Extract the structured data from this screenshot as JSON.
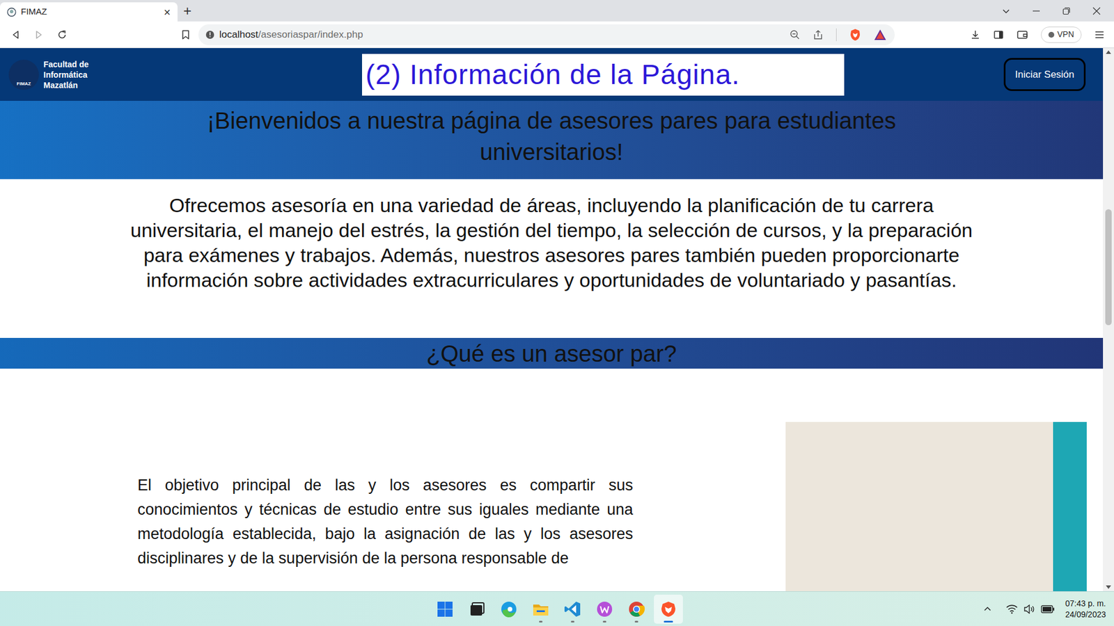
{
  "window": {
    "url_host": "localhost",
    "url_path": "/asesoriaspar/index.php",
    "vpn": "VPN"
  },
  "tabs": [
    {
      "label": "FIMAZ",
      "selected": true,
      "close": "×"
    }
  ],
  "new_tab": "+",
  "header": {
    "logo_mark": "FIMAZ",
    "logo_lines": [
      "Facultad de",
      "Informática",
      "Mazatlán"
    ],
    "title": "(2) Información de la Página.",
    "login": "Iniciar Sesión"
  },
  "banner": {
    "heading": "¡Bienvenidos a nuestra página de asesores pares para estudiantes universitarios!"
  },
  "intro": "Ofrecemos asesoría en una variedad de áreas, incluyendo la planificación de tu carrera universitaria, el manejo del estrés, la gestión del tiempo, la selección de cursos, y la preparación para exámenes y trabajos. Además, nuestros asesores pares también pueden proporcionarte información sobre actividades extracurriculares y oportunidades de voluntariado y pasantías.",
  "section": {
    "heading": "¿Qué es un asesor par?",
    "text": "El objetivo principal de las y los asesores es compartir sus conocimientos y técnicas de estudio entre sus iguales mediante una metodología establecida, bajo la asignación de las y los asesores disciplinares y de la supervisión de la persona responsable de"
  },
  "taskbar": {
    "apps": [
      {
        "kind": "start",
        "running": false,
        "active": false
      },
      {
        "kind": "taskview",
        "running": false,
        "active": false
      },
      {
        "kind": "edge",
        "running": false,
        "active": false
      },
      {
        "kind": "files",
        "running": true,
        "active": false
      },
      {
        "kind": "vscode",
        "running": true,
        "active": false
      },
      {
        "kind": "wapp",
        "running": true,
        "active": false
      },
      {
        "kind": "chrome",
        "running": true,
        "active": false
      },
      {
        "kind": "brave",
        "running": true,
        "active": true
      }
    ],
    "time": "07:43 p. m.",
    "date": "24/09/2023"
  }
}
